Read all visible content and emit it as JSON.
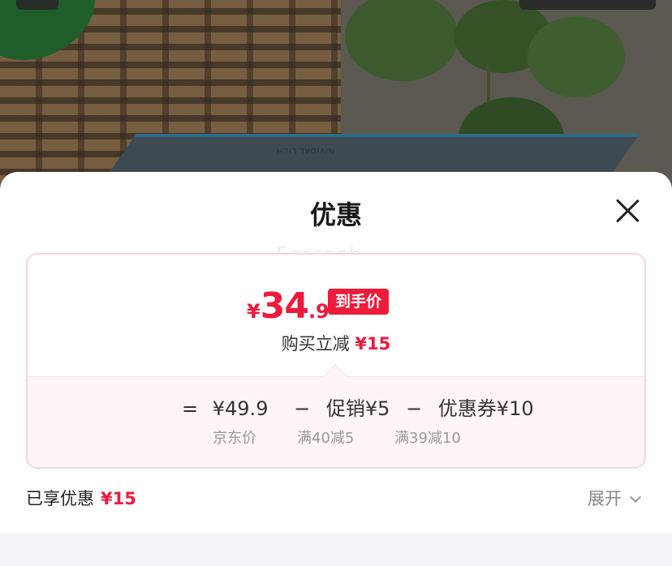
{
  "backdrop": {
    "book_text": "NIVIDAL LICH"
  },
  "sheet": {
    "title": "优惠",
    "close_label": "",
    "watermark": "Forcash"
  },
  "price_card": {
    "currency": "¥",
    "final_int": "34",
    "final_dec": ".9",
    "final_tag": "到手价",
    "reduce_label": "购买立减",
    "reduce_amount": "¥15",
    "formula": {
      "equals": "=",
      "base": "¥49.9",
      "minus1": "−",
      "promo": "促销¥5",
      "minus2": "−",
      "coupon": "优惠券¥10"
    },
    "notes": {
      "base_note": "京东价",
      "promo_note": "满40减5",
      "coupon_note": "满39减10"
    }
  },
  "footer": {
    "enjoyed_label": "已享优惠",
    "enjoyed_amount": "¥15",
    "expand_label": "展开"
  }
}
